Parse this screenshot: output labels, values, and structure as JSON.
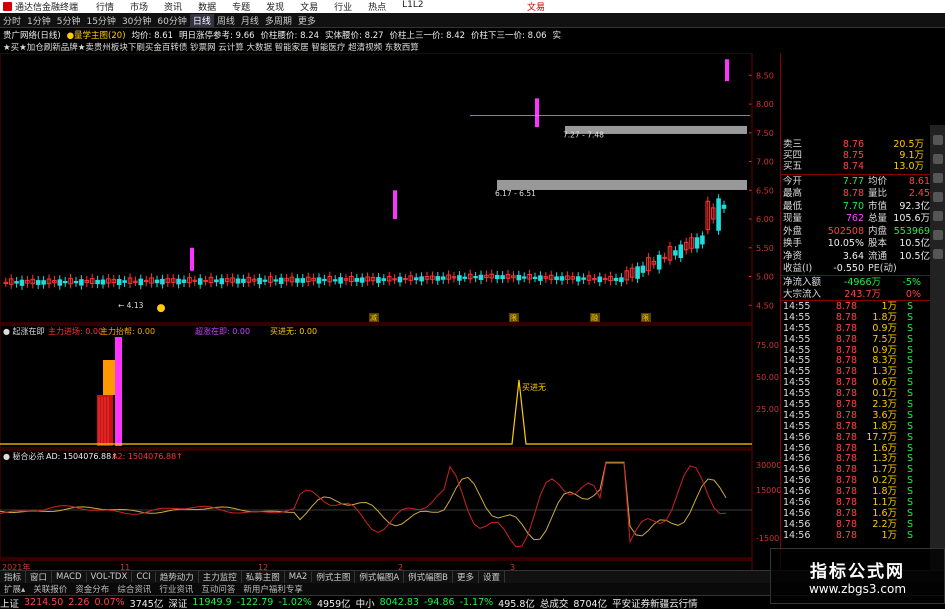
{
  "window": {
    "app_title": "通达信金融终端",
    "menu": [
      "行情",
      "市场",
      "资讯",
      "数据",
      "专题",
      "发现",
      "文易",
      "行业",
      "热点",
      "L1L2"
    ],
    "broker_label": "文易"
  },
  "toolbar": {
    "periods": [
      "分时",
      "1分钟",
      "5分钟",
      "15分钟",
      "30分钟",
      "60分钟",
      "日线",
      "周线",
      "月线",
      "多周期",
      "更多"
    ],
    "active": "日线"
  },
  "infoline": {
    "stock_name": "贵广网络(日线)",
    "indicator": "●量学主图(20)",
    "items": [
      {
        "label": "均价: 8.61",
        "color": "#eeeeee"
      },
      {
        "label": "明日涨停参考: 9.66",
        "color": "#eeeeee"
      },
      {
        "label": "价柱腰价: 8.24",
        "color": "#eeeeee"
      },
      {
        "label": "实体腰价: 8.27",
        "color": "#eeeeee"
      },
      {
        "label": "价柱上三一价: 8.42",
        "color": "#eeeeee"
      },
      {
        "label": "价柱下三一价: 8.06",
        "color": "#eeeeee"
      },
      {
        "label": "实",
        "color": "#eeeeee"
      }
    ]
  },
  "ticker_text": "★买★加仓刷新品牌★卖贵州板块下刷买金百转债 钞票网 云计算 大数据 智能家居 智能医疗 超清视频 东数西算",
  "price_axis": [
    "8.50",
    "8.00",
    "7.50",
    "7.00",
    "6.50",
    "6.00",
    "5.50",
    "5.00",
    "4.50"
  ],
  "annotations": {
    "range1": "7.27 - 7.48",
    "range2": "6.17 - 6.51",
    "low_mark": "4.13",
    "sub1_peak": "买进无"
  },
  "event_markers": [
    "减",
    "限",
    "融",
    "限"
  ],
  "indicator1": {
    "name": "起涨在即",
    "items": [
      {
        "label": "主力进场: 0.00",
        "color": "#ff3333"
      },
      {
        "label": "主力抬帮: 0.00",
        "color": "#ffaa00"
      },
      {
        "label": "超涨在即: 0.00",
        "color": "#cc44ff"
      },
      {
        "label": "买进无: 0.00",
        "color": "#ffcc00"
      }
    ],
    "axis": [
      "75.00",
      "50.00",
      "25.00"
    ]
  },
  "indicator2": {
    "name": "秘合必杀",
    "items": [
      {
        "label": "AD: 1504076.88↑",
        "color": "#eeeeee"
      },
      {
        "label": "A2: 1504076.88↑",
        "color": "#ff3333"
      }
    ],
    "axis": [
      "30000",
      "15000",
      "-15000"
    ]
  },
  "date_axis": [
    "2021年",
    "11",
    "12",
    "2",
    "3"
  ],
  "side_quote": {
    "asks": [
      {
        "label": "卖三",
        "price": "8.76",
        "qty": "20.5万"
      },
      {
        "label": "买四",
        "price": "8.75",
        "qty": "9.1万"
      },
      {
        "label": "买五",
        "price": "8.74",
        "qty": "13.0万"
      }
    ],
    "stats": [
      {
        "l1": "今开",
        "v1": "7.77",
        "c1": "green",
        "l2": "均价",
        "v2": "8.61",
        "c2": "red"
      },
      {
        "l1": "最高",
        "v1": "8.78",
        "c1": "red",
        "l2": "量比",
        "v2": "2.45",
        "c2": "red"
      },
      {
        "l1": "最低",
        "v1": "7.70",
        "c1": "green",
        "l2": "市值",
        "v2": "92.3亿",
        "c2": "white"
      },
      {
        "l1": "现量",
        "v1": "762",
        "c1": "magenta",
        "l2": "总量",
        "v2": "105.6万",
        "c2": "white"
      },
      {
        "l1": "外盘",
        "v1": "502508",
        "c1": "red",
        "l2": "内盘",
        "v2": "553969",
        "c2": "green"
      },
      {
        "l1": "换手",
        "v1": "10.05%",
        "c1": "white",
        "l2": "股本",
        "v2": "10.5亿",
        "c2": "white"
      },
      {
        "l1": "净资",
        "v1": "3.64",
        "c1": "white",
        "l2": "流通",
        "v2": "10.5亿",
        "c2": "white"
      },
      {
        "l1": "收益(Ⅰ)",
        "v1": "-0.550",
        "c1": "white",
        "l2": "PE(动)",
        "v2": "",
        "c2": "white"
      }
    ],
    "flows": [
      {
        "label": "净流入额",
        "value": "-4966万",
        "pct": "-5%",
        "color": "green"
      },
      {
        "label": "大宗流入",
        "value": "243.7万",
        "pct": "0%",
        "color": "red"
      }
    ],
    "ticks": [
      {
        "t": "14:55",
        "p": "8.78",
        "v": "1万",
        "bs": "S"
      },
      {
        "t": "14:55",
        "p": "8.78",
        "v": "1.8万",
        "bs": "S"
      },
      {
        "t": "14:55",
        "p": "8.78",
        "v": "0.9万",
        "bs": "S"
      },
      {
        "t": "14:55",
        "p": "8.78",
        "v": "7.5万",
        "bs": "S"
      },
      {
        "t": "14:55",
        "p": "8.78",
        "v": "0.9万",
        "bs": "S"
      },
      {
        "t": "14:55",
        "p": "8.78",
        "v": "8.3万",
        "bs": "S"
      },
      {
        "t": "14:55",
        "p": "8.78",
        "v": "1.3万",
        "bs": "S"
      },
      {
        "t": "14:55",
        "p": "8.78",
        "v": "0.6万",
        "bs": "S"
      },
      {
        "t": "14:55",
        "p": "8.78",
        "v": "0.1万",
        "bs": "S"
      },
      {
        "t": "14:55",
        "p": "8.78",
        "v": "2.3万",
        "bs": "S"
      },
      {
        "t": "14:55",
        "p": "8.78",
        "v": "3.6万",
        "bs": "S"
      },
      {
        "t": "14:55",
        "p": "8.78",
        "v": "1.8万",
        "bs": "S"
      },
      {
        "t": "14:56",
        "p": "8.78",
        "v": "17.7万",
        "bs": "S"
      },
      {
        "t": "14:56",
        "p": "8.78",
        "v": "1.6万",
        "bs": "S"
      },
      {
        "t": "14:56",
        "p": "8.78",
        "v": "1.3万",
        "bs": "S"
      },
      {
        "t": "14:56",
        "p": "8.78",
        "v": "1.7万",
        "bs": "S"
      },
      {
        "t": "14:56",
        "p": "8.78",
        "v": "0.2万",
        "bs": "S"
      },
      {
        "t": "14:56",
        "p": "8.78",
        "v": "1.8万",
        "bs": "S"
      },
      {
        "t": "14:56",
        "p": "8.78",
        "v": "1.1万",
        "bs": "S"
      },
      {
        "t": "14:56",
        "p": "8.78",
        "v": "1.6万",
        "bs": "S"
      },
      {
        "t": "14:56",
        "p": "8.78",
        "v": "2.2万",
        "bs": "S"
      },
      {
        "t": "14:56",
        "p": "8.78",
        "v": "1万",
        "bs": "S"
      }
    ]
  },
  "bottom_tabs": [
    "指标",
    "窗口",
    "MACD",
    "VOL-TDX",
    "CCI",
    "趋势动力",
    "主力监控",
    "私募主图",
    "MA2",
    "例式主图",
    "例式幅图A",
    "例式幅图B",
    "更多",
    "设置"
  ],
  "bottom_tabs2": [
    "扩展▴",
    "关联报价",
    "资金分布",
    "综合资讯",
    "行业资讯",
    "互动问答",
    "新用户福利专享"
  ],
  "status": [
    {
      "label": "上证",
      "color": "#eeeeee"
    },
    {
      "label": "3214.50",
      "color": "#ff4444"
    },
    {
      "label": "2.26",
      "color": "#ff4444"
    },
    {
      "label": "0.07%",
      "color": "#ff4444"
    },
    {
      "label": "3745亿",
      "color": "#eeeeee"
    },
    {
      "label": "深证",
      "color": "#eeeeee"
    },
    {
      "label": "11949.9",
      "color": "#22ee44"
    },
    {
      "label": "-122.79",
      "color": "#22ee44"
    },
    {
      "label": "-1.02%",
      "color": "#22ee44"
    },
    {
      "label": "4959亿",
      "color": "#eeeeee"
    },
    {
      "label": "中小",
      "color": "#eeeeee"
    },
    {
      "label": "8042.83",
      "color": "#22ee44"
    },
    {
      "label": "-94.86",
      "color": "#22ee44"
    },
    {
      "label": "-1.17%",
      "color": "#22ee44"
    },
    {
      "label": "495.8亿",
      "color": "#eeeeee"
    },
    {
      "label": "总成交",
      "color": "#eeeeee"
    },
    {
      "label": "8704亿",
      "color": "#eeeeee"
    },
    {
      "label": "平安证券新疆云行情",
      "color": "#eeeeee"
    }
  ],
  "watermark": {
    "title": "指标公式网",
    "url": "www.zbgs3.com"
  },
  "colors": {
    "up": "#ff3333",
    "down": "#22dddd",
    "magenta": "#ff33ff",
    "grid": "#660000"
  }
}
